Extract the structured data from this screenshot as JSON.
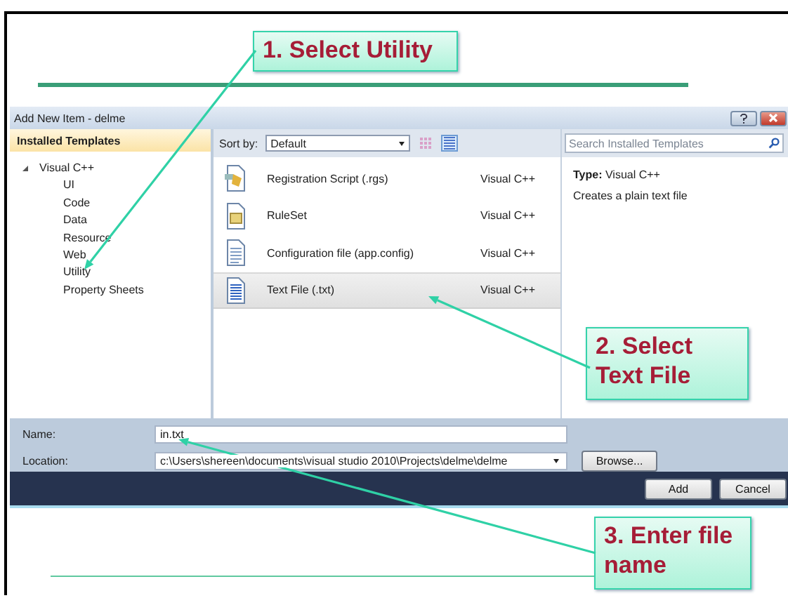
{
  "callouts": [
    {
      "text": "1. Select Utility"
    },
    {
      "text": "2. Select Text File"
    },
    {
      "text": "3. Enter file name"
    }
  ],
  "dialog": {
    "title": "Add New Item - delme",
    "sidebar": {
      "header": "Installed Templates",
      "tree": [
        {
          "label": "Visual C++",
          "expanded": true,
          "selected": false,
          "children": [
            {
              "label": "UI",
              "selected": false
            },
            {
              "label": "Code",
              "selected": false
            },
            {
              "label": "Data",
              "selected": false
            },
            {
              "label": "Resource",
              "selected": false
            },
            {
              "label": "Web",
              "selected": false
            },
            {
              "label": "Utility",
              "selected": false
            },
            {
              "label": "Property Sheets",
              "selected": false
            }
          ]
        }
      ]
    },
    "toolbar": {
      "sort_label": "Sort by:",
      "sort_value": "Default",
      "views": [
        {
          "selected": false
        },
        {
          "selected": true
        }
      ]
    },
    "search": {
      "placeholder": "Search Installed Templates"
    },
    "templates": [
      {
        "name": "Registration Script (.rgs)",
        "language": "Visual C++",
        "kind": "script",
        "selected": false
      },
      {
        "name": "RuleSet",
        "language": "Visual C++",
        "kind": "ruleset",
        "selected": false
      },
      {
        "name": "Configuration file (app.config)",
        "language": "Visual C++",
        "kind": "config",
        "selected": false
      },
      {
        "name": "Text File (.txt)",
        "language": "Visual C++",
        "kind": "text",
        "selected": true
      }
    ],
    "details": {
      "type": "**Type:**  Visual C++",
      "description": "Creates a plain text file"
    },
    "form": {
      "name_label": "Name:",
      "name_value": "in.txt",
      "location_label": "Location:",
      "location_value": "c:\\Users\\shereen\\documents\\visual studio 2010\\Projects\\delme\\delme",
      "browse": "Browse..."
    },
    "buttons": [
      "Add",
      "Cancel"
    ]
  }
}
